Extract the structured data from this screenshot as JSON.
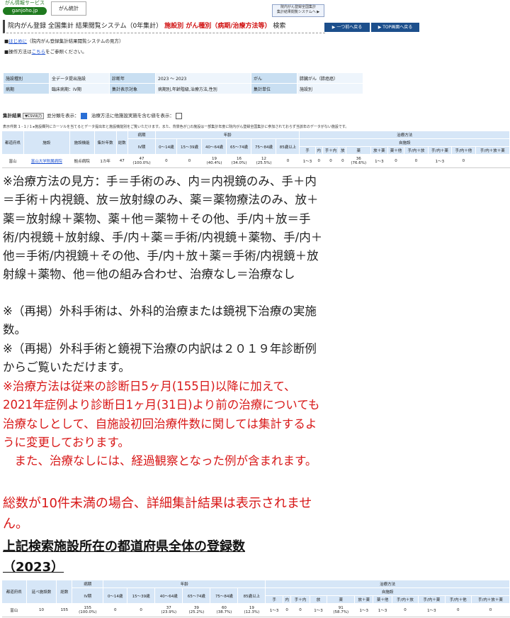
{
  "header": {
    "logo_line1": "がん情報サービス",
    "logo_line2": "ganjoho.jp",
    "tab_label": "がん統計",
    "banner_line1": "院内がん登録全国集計",
    "banner_line2": "集計結果閲覧システムへ ▶"
  },
  "title": {
    "main": "院内がん登録 全国集計 結果閲覧システム（0年集計）",
    "red": "施設別 がん種別（病期/治療方法等）",
    "tail": "検索",
    "back_button": "▶ 一つ前へ戻る",
    "top_button": "▶ TOP画面へ戻る"
  },
  "intro": {
    "line1_prefix": "■",
    "line1_link": "はじめに",
    "line1_rest": "（院内がん登録集計結果閲覧システムの見方）",
    "line2_prefix": "■操作方法は",
    "line2_link": "こちら",
    "line2_rest": "をご参照ください。"
  },
  "conditions": [
    {
      "l1": "施設種別",
      "v1": "全データ提出施設",
      "l2": "診断年",
      "v2": "2023 ～ 2023",
      "l3": "がん",
      "v3": "膵臓がん（膵癌癌）"
    },
    {
      "l1": "病期",
      "v1": "臨床病期：IV期",
      "l2": "集計表示対象",
      "v2": "病期別,年齢階級,治療方法,性別",
      "l3": "集計単位",
      "v3": "施設別"
    }
  ],
  "results_bar": {
    "label": "集計結果",
    "csv": "▼CSV出力",
    "show_sections": "並分類を表示：",
    "show_zero": "治療方法に他施設実施を含む値を表示："
  },
  "table_note": "表示件数 1 - 1 / 1 ▸施設欄列にカーソルを当てるとデータ提出年と施設機能別をご覧いただけます。また、背景色が□の施設は一部集計年度に院内がん登録全国集計に参加されておらず当該年のデータがない施設です。",
  "table1": {
    "headers": {
      "pref": "都道府県",
      "facility": "施設",
      "func": "施設機能",
      "years": "集計年数",
      "total": "総数",
      "stage": "病期",
      "stage_sub": "IV期",
      "age": "年齢",
      "treat": "治療方法",
      "treat_sub": "自施設",
      "ages": [
        "0〜14歳",
        "15〜39歳",
        "40〜64歳",
        "65〜74歳",
        "75〜84歳",
        "85歳以上"
      ],
      "treats": [
        "手",
        "内",
        "手＋内",
        "放",
        "薬",
        "放＋薬",
        "薬＋他",
        "手/内＋放",
        "手/内＋薬",
        "手/内＋他",
        "手/内＋放＋薬"
      ]
    },
    "row": {
      "pref": "富山",
      "facility": "富山大学附属病院",
      "func": "拠点病院",
      "years": "1カ年",
      "total": "47",
      "stage": "47",
      "stage_pct": "(100.0%)",
      "ages": [
        {
          "v": "0",
          "p": ""
        },
        {
          "v": "0",
          "p": ""
        },
        {
          "v": "19",
          "p": "(40.4%)"
        },
        {
          "v": "16",
          "p": "(34.0%)"
        },
        {
          "v": "12",
          "p": "(25.5%)"
        },
        {
          "v": "0",
          "p": ""
        }
      ],
      "treats": [
        {
          "v": "1〜3",
          "p": ""
        },
        {
          "v": "0",
          "p": ""
        },
        {
          "v": "0",
          "p": ""
        },
        {
          "v": "0",
          "p": ""
        },
        {
          "v": "36",
          "p": "(76.6%)"
        },
        {
          "v": "1〜3",
          "p": ""
        },
        {
          "v": "0",
          "p": ""
        },
        {
          "v": "0",
          "p": ""
        },
        {
          "v": "1〜3",
          "p": ""
        },
        {
          "v": "0",
          "p": ""
        },
        {
          "v": "",
          "p": ""
        }
      ]
    }
  },
  "notes": {
    "n1": "※治療方法の見方：手＝手術のみ、内＝内視鏡のみ、手＋内＝手術＋内視鏡、放＝放射線のみ、薬＝薬物療法のみ、放＋薬＝放射線＋薬物、薬＋他＝薬物＋その他、手/内＋放＝手術/内視鏡＋放射線、手/内＋薬＝手術/内視鏡＋薬物、手/内＋他＝手術/内視鏡＋その他、手/内＋放＋薬＝手術/内視鏡＋放射線＋薬物、他＝他の組み合わせ、治療なし＝治療なし",
    "n2": "※（再掲）外科手術は、外科的治療または鏡視下治療の実施数。",
    "n3": "※（再掲）外科手術と鏡視下治療の内訳は２０１９年診断例からご覧いただけます。",
    "n4": "※治療方法は従来の診断日5ヶ月(155日)以降に加えて、2021年症例より診断日1ヶ月(31日)より前の治療についても治療なしとして、自施設初回治療件数に関しては集計するように変更しております。",
    "n5": "　また、治療なしには、経過観察となった例が含まれます。",
    "n6": "総数が10件未満の場合、詳細集計結果は表示されません。",
    "heading": "上記検索施設所在の都道府県全体の登録数（2023）"
  },
  "table2": {
    "headers": {
      "pref": "都道府県",
      "fac_count": "延べ施設数",
      "total": "総数",
      "stage": "病期",
      "stage_sub": "IV期",
      "age": "年齢",
      "treat": "治療方法",
      "treat_sub": "自施設"
    },
    "row": {
      "pref": "富山",
      "fac_count": "10",
      "total": "155",
      "stage": "155",
      "stage_pct": "(100.0%)",
      "ages": [
        {
          "v": "0",
          "p": ""
        },
        {
          "v": "0",
          "p": ""
        },
        {
          "v": "37",
          "p": "(23.9%)"
        },
        {
          "v": "39",
          "p": "(25.2%)"
        },
        {
          "v": "60",
          "p": "(38.7%)"
        },
        {
          "v": "19",
          "p": "(12.3%)"
        }
      ],
      "treats": [
        {
          "v": "1〜3",
          "p": ""
        },
        {
          "v": "0",
          "p": ""
        },
        {
          "v": "0",
          "p": ""
        },
        {
          "v": "1〜3",
          "p": ""
        },
        {
          "v": "91",
          "p": "(58.7%)"
        },
        {
          "v": "1〜3",
          "p": ""
        },
        {
          "v": "1〜3",
          "p": ""
        },
        {
          "v": "0",
          "p": ""
        },
        {
          "v": "1〜3",
          "p": ""
        },
        {
          "v": "0",
          "p": ""
        },
        {
          "v": "0",
          "p": ""
        }
      ]
    }
  }
}
